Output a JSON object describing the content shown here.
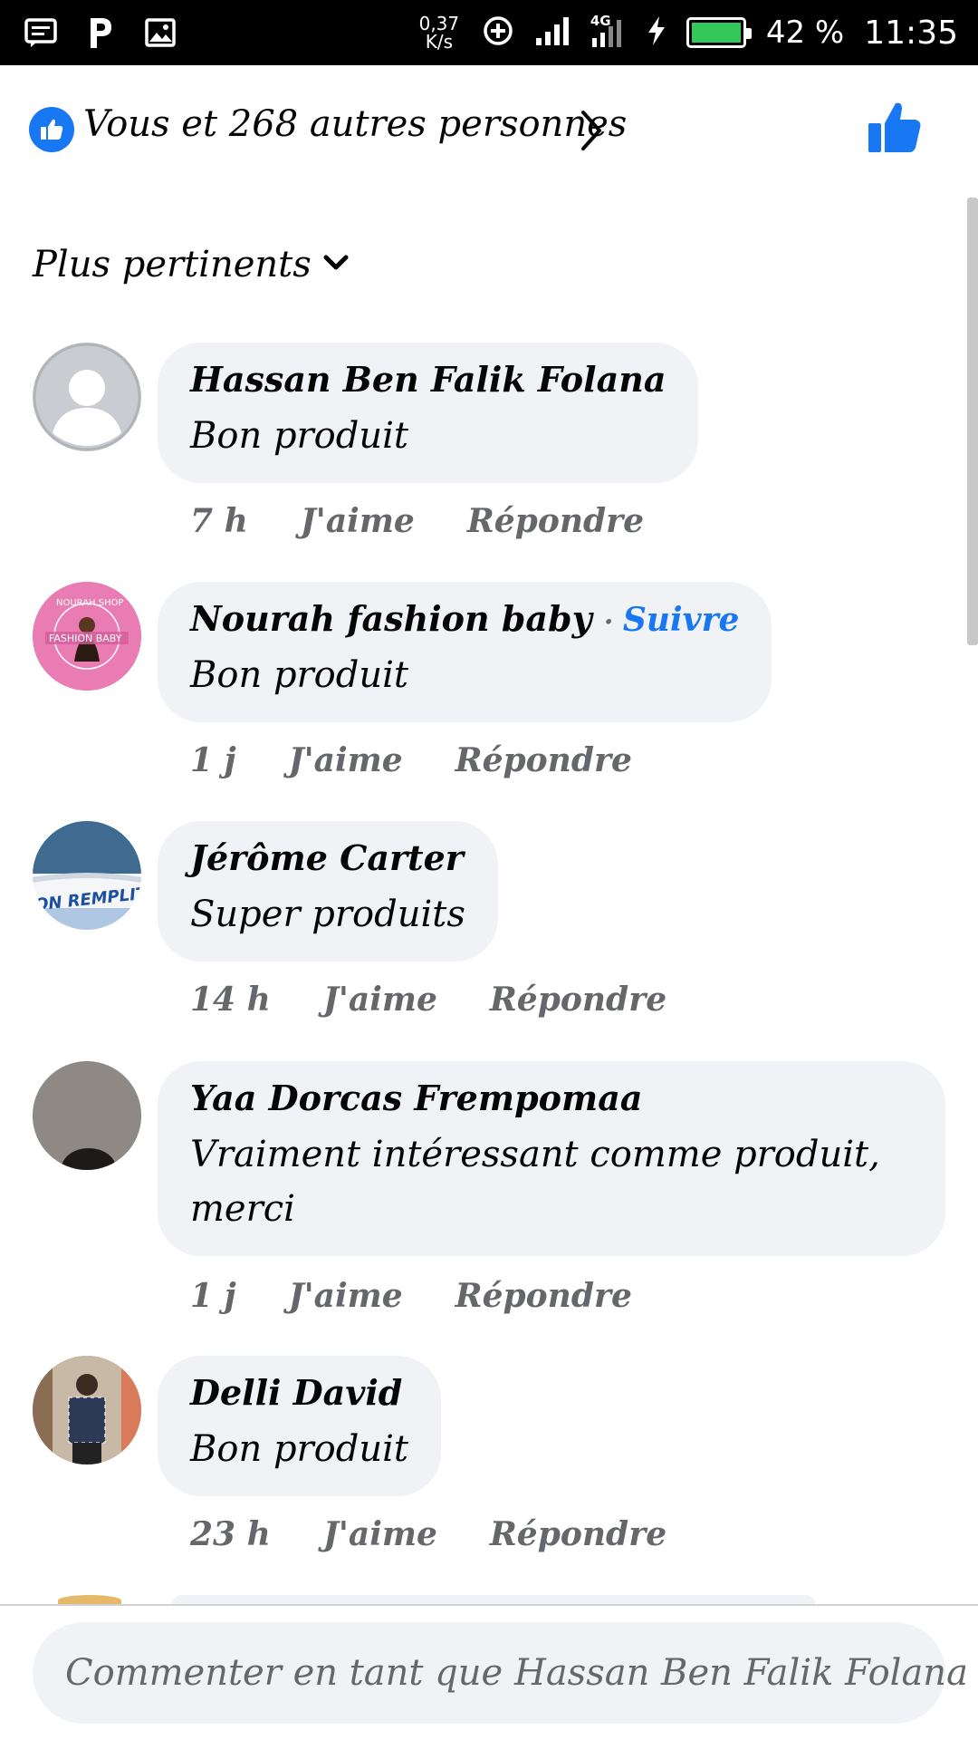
{
  "status_bar": {
    "net_speed": "0,37\nK/s",
    "network": "4G",
    "battery_pct": "42 %",
    "battery_level": 0.42,
    "time": "11:35"
  },
  "reactions": {
    "summary": "Vous et 268 autres personnes",
    "like_color": "#1877f2"
  },
  "sort": {
    "label": "Plus pertinents"
  },
  "comments": [
    {
      "author": "Hassan Ben Falik Folana",
      "text": "Bon produit",
      "time": "7 h",
      "like": "J'aime",
      "reply": "Répondre"
    },
    {
      "author": "Nourah fashion baby",
      "follow": "Suivre",
      "text": "Bon produit",
      "time": "1 j",
      "like": "J'aime",
      "reply": "Répondre",
      "avatar_badge_line1": "NOURAH SHOP",
      "avatar_badge_line2": "FASHION BABY"
    },
    {
      "author": "Jérôme Carter",
      "text": "Super produits",
      "time": "14 h",
      "like": "J'aime",
      "reply": "Répondre",
      "avatar_badge": "ON REMPLIT"
    },
    {
      "author": "Yaa Dorcas Frempomaa",
      "text": "Vraiment  intéressant comme produit, merci",
      "time": "1 j",
      "like": "J'aime",
      "reply": "Répondre"
    },
    {
      "author": "Delli David",
      "text": "Bon produit",
      "time": "23 h",
      "like": "J'aime",
      "reply": "Répondre"
    }
  ],
  "composer": {
    "placeholder": "Commenter en tant que Hassan Ben Falik Folana"
  }
}
